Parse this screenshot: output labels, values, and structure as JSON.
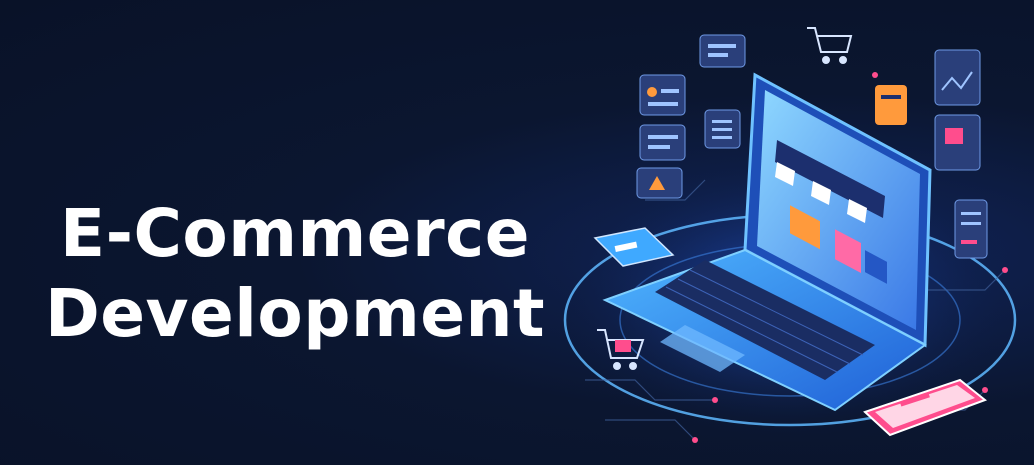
{
  "banner": {
    "headline_line1": "E-Commerce",
    "headline_line2": "Development"
  },
  "colors": {
    "background": "#0b1630",
    "headline": "#ffffff",
    "accent_blue": "#3fa9ff",
    "accent_pink": "#ff4d8d",
    "accent_orange": "#ff9a3c"
  },
  "illustration": {
    "subject": "isometric laptop with online storefront",
    "icons": [
      "laptop-icon",
      "storefront-awning-icon",
      "shopping-cart-icon",
      "smartphone-icon",
      "credit-card-icon",
      "chat-card-icon",
      "chart-card-icon"
    ]
  }
}
